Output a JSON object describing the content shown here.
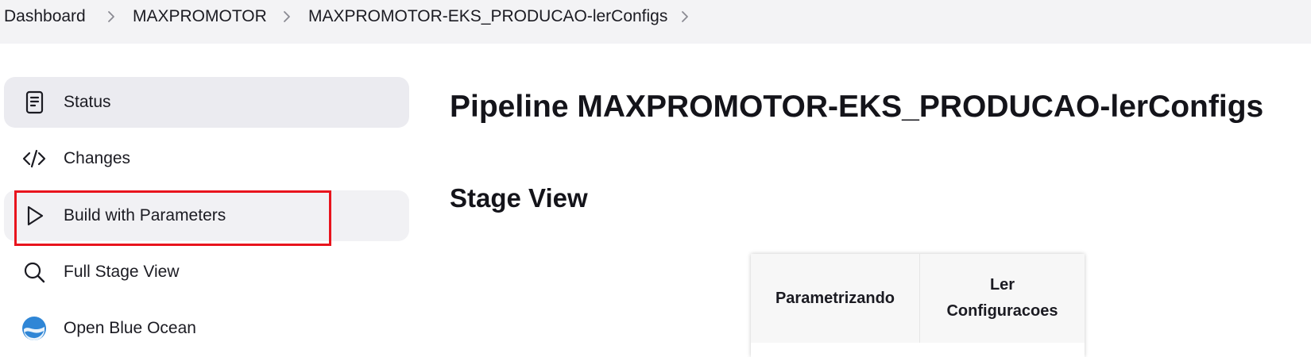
{
  "breadcrumb": {
    "items": [
      {
        "label": "Dashboard"
      },
      {
        "label": "MAXPROMOTOR"
      },
      {
        "label": "MAXPROMOTOR-EKS_PRODUCAO-lerConfigs"
      }
    ]
  },
  "sidebar": {
    "items": [
      {
        "label": "Status",
        "icon": "document-icon"
      },
      {
        "label": "Changes",
        "icon": "code-icon"
      },
      {
        "label": "Build with Parameters",
        "icon": "play-icon"
      },
      {
        "label": "Full Stage View",
        "icon": "search-icon"
      },
      {
        "label": "Open Blue Ocean",
        "icon": "blue-ocean-icon"
      }
    ]
  },
  "main": {
    "title": "Pipeline MAXPROMOTOR-EKS_PRODUCAO-lerConfigs",
    "stage_view_title": "Stage View",
    "stages": [
      {
        "name": "Parametrizando",
        "lines": [
          "Parametrizando"
        ]
      },
      {
        "name": "Ler Configuracoes",
        "lines": [
          "Ler",
          "Configuracoes"
        ]
      }
    ]
  },
  "colors": {
    "highlight": "#e8141d",
    "breadcrumb_bg": "#f3f3f5",
    "active_item_bg": "#ebebf0"
  }
}
